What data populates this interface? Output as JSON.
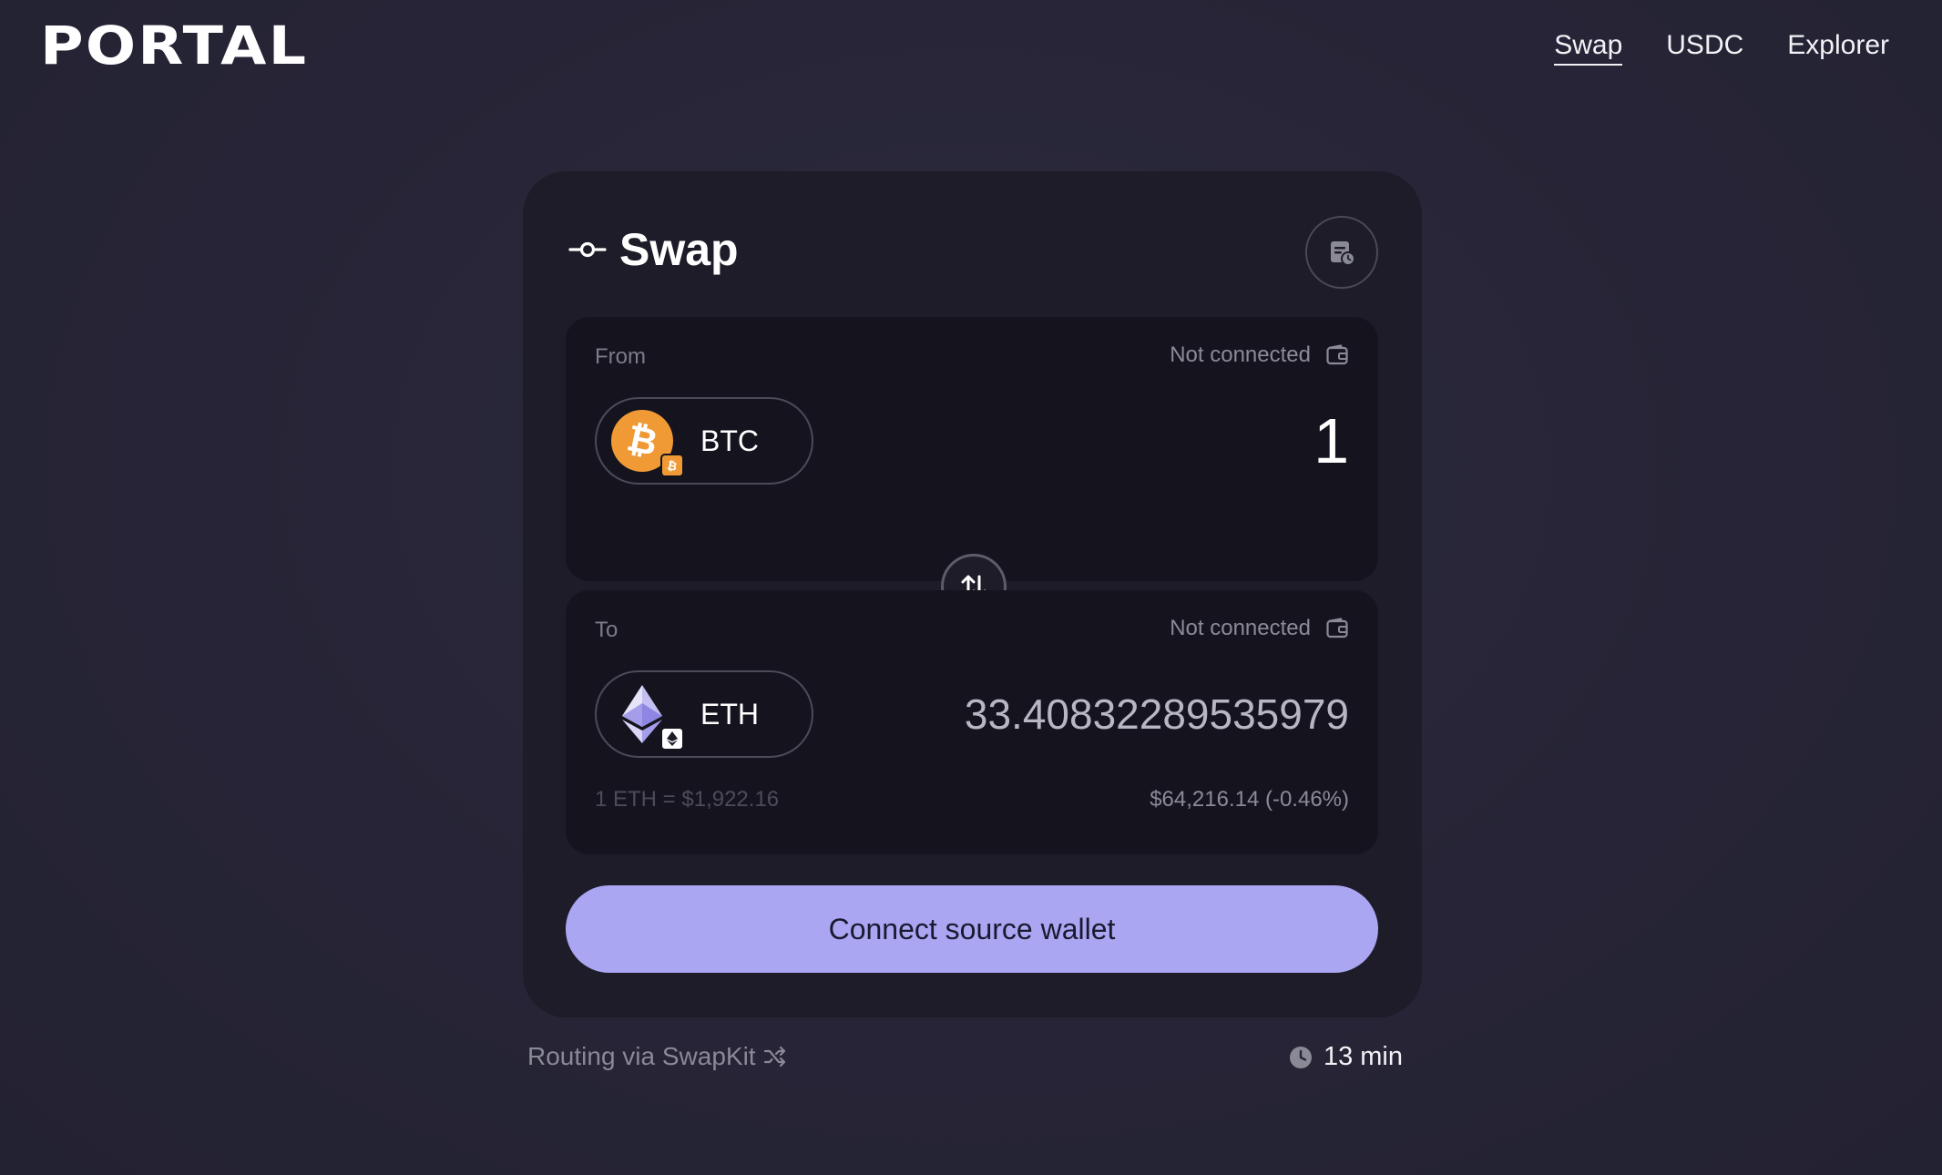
{
  "header": {
    "logo": "PORTAL",
    "nav": [
      {
        "label": "Swap",
        "active": true
      },
      {
        "label": "USDC",
        "active": false
      },
      {
        "label": "Explorer",
        "active": false
      }
    ]
  },
  "card": {
    "title": "Swap",
    "icons": {
      "title": "swap-route-icon",
      "history": "history-icon",
      "wallet": "wallet-icon",
      "toggle": "swap-arrows-icon"
    },
    "from": {
      "label": "From",
      "status": "Not connected",
      "token": "BTC",
      "amount": "1",
      "token_color": "#f09a36"
    },
    "to": {
      "label": "To",
      "status": "Not connected",
      "token": "ETH",
      "amount": "33.40832289535979",
      "rate": "1 ETH = $1,922.16",
      "usd_value": "$64,216.14 (-0.46%)"
    },
    "cta_label": "Connect source wallet",
    "cta_color": "#aaa6f2"
  },
  "footer": {
    "routing": "Routing via SwapKit",
    "eta": "13 min"
  }
}
